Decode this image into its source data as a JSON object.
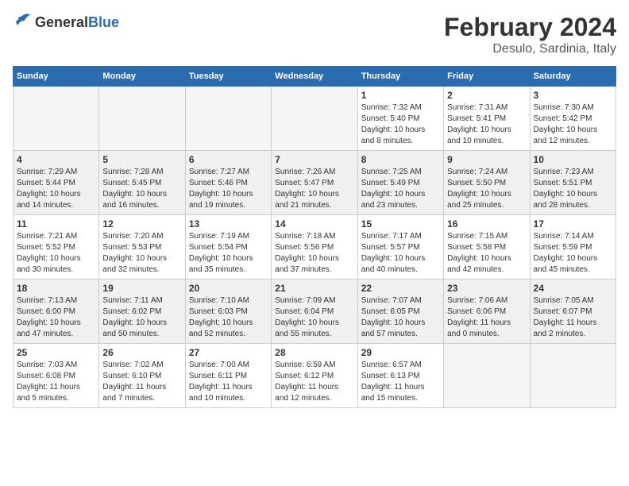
{
  "header": {
    "logo": {
      "general": "General",
      "blue": "Blue"
    },
    "title": "February 2024",
    "subtitle": "Desulo, Sardinia, Italy"
  },
  "calendar": {
    "weekdays": [
      "Sunday",
      "Monday",
      "Tuesday",
      "Wednesday",
      "Thursday",
      "Friday",
      "Saturday"
    ],
    "weeks": [
      [
        {
          "day": "",
          "info": ""
        },
        {
          "day": "",
          "info": ""
        },
        {
          "day": "",
          "info": ""
        },
        {
          "day": "",
          "info": ""
        },
        {
          "day": "1",
          "info": "Sunrise: 7:32 AM\nSunset: 5:40 PM\nDaylight: 10 hours\nand 8 minutes."
        },
        {
          "day": "2",
          "info": "Sunrise: 7:31 AM\nSunset: 5:41 PM\nDaylight: 10 hours\nand 10 minutes."
        },
        {
          "day": "3",
          "info": "Sunrise: 7:30 AM\nSunset: 5:42 PM\nDaylight: 10 hours\nand 12 minutes."
        }
      ],
      [
        {
          "day": "4",
          "info": "Sunrise: 7:29 AM\nSunset: 5:44 PM\nDaylight: 10 hours\nand 14 minutes."
        },
        {
          "day": "5",
          "info": "Sunrise: 7:28 AM\nSunset: 5:45 PM\nDaylight: 10 hours\nand 16 minutes."
        },
        {
          "day": "6",
          "info": "Sunrise: 7:27 AM\nSunset: 5:46 PM\nDaylight: 10 hours\nand 19 minutes."
        },
        {
          "day": "7",
          "info": "Sunrise: 7:26 AM\nSunset: 5:47 PM\nDaylight: 10 hours\nand 21 minutes."
        },
        {
          "day": "8",
          "info": "Sunrise: 7:25 AM\nSunset: 5:49 PM\nDaylight: 10 hours\nand 23 minutes."
        },
        {
          "day": "9",
          "info": "Sunrise: 7:24 AM\nSunset: 5:50 PM\nDaylight: 10 hours\nand 25 minutes."
        },
        {
          "day": "10",
          "info": "Sunrise: 7:23 AM\nSunset: 5:51 PM\nDaylight: 10 hours\nand 28 minutes."
        }
      ],
      [
        {
          "day": "11",
          "info": "Sunrise: 7:21 AM\nSunset: 5:52 PM\nDaylight: 10 hours\nand 30 minutes."
        },
        {
          "day": "12",
          "info": "Sunrise: 7:20 AM\nSunset: 5:53 PM\nDaylight: 10 hours\nand 32 minutes."
        },
        {
          "day": "13",
          "info": "Sunrise: 7:19 AM\nSunset: 5:54 PM\nDaylight: 10 hours\nand 35 minutes."
        },
        {
          "day": "14",
          "info": "Sunrise: 7:18 AM\nSunset: 5:56 PM\nDaylight: 10 hours\nand 37 minutes."
        },
        {
          "day": "15",
          "info": "Sunrise: 7:17 AM\nSunset: 5:57 PM\nDaylight: 10 hours\nand 40 minutes."
        },
        {
          "day": "16",
          "info": "Sunrise: 7:15 AM\nSunset: 5:58 PM\nDaylight: 10 hours\nand 42 minutes."
        },
        {
          "day": "17",
          "info": "Sunrise: 7:14 AM\nSunset: 5:59 PM\nDaylight: 10 hours\nand 45 minutes."
        }
      ],
      [
        {
          "day": "18",
          "info": "Sunrise: 7:13 AM\nSunset: 6:00 PM\nDaylight: 10 hours\nand 47 minutes."
        },
        {
          "day": "19",
          "info": "Sunrise: 7:11 AM\nSunset: 6:02 PM\nDaylight: 10 hours\nand 50 minutes."
        },
        {
          "day": "20",
          "info": "Sunrise: 7:10 AM\nSunset: 6:03 PM\nDaylight: 10 hours\nand 52 minutes."
        },
        {
          "day": "21",
          "info": "Sunrise: 7:09 AM\nSunset: 6:04 PM\nDaylight: 10 hours\nand 55 minutes."
        },
        {
          "day": "22",
          "info": "Sunrise: 7:07 AM\nSunset: 6:05 PM\nDaylight: 10 hours\nand 57 minutes."
        },
        {
          "day": "23",
          "info": "Sunrise: 7:06 AM\nSunset: 6:06 PM\nDaylight: 11 hours\nand 0 minutes."
        },
        {
          "day": "24",
          "info": "Sunrise: 7:05 AM\nSunset: 6:07 PM\nDaylight: 11 hours\nand 2 minutes."
        }
      ],
      [
        {
          "day": "25",
          "info": "Sunrise: 7:03 AM\nSunset: 6:08 PM\nDaylight: 11 hours\nand 5 minutes."
        },
        {
          "day": "26",
          "info": "Sunrise: 7:02 AM\nSunset: 6:10 PM\nDaylight: 11 hours\nand 7 minutes."
        },
        {
          "day": "27",
          "info": "Sunrise: 7:00 AM\nSunset: 6:11 PM\nDaylight: 11 hours\nand 10 minutes."
        },
        {
          "day": "28",
          "info": "Sunrise: 6:59 AM\nSunset: 6:12 PM\nDaylight: 11 hours\nand 12 minutes."
        },
        {
          "day": "29",
          "info": "Sunrise: 6:57 AM\nSunset: 6:13 PM\nDaylight: 11 hours\nand 15 minutes."
        },
        {
          "day": "",
          "info": ""
        },
        {
          "day": "",
          "info": ""
        }
      ]
    ]
  }
}
